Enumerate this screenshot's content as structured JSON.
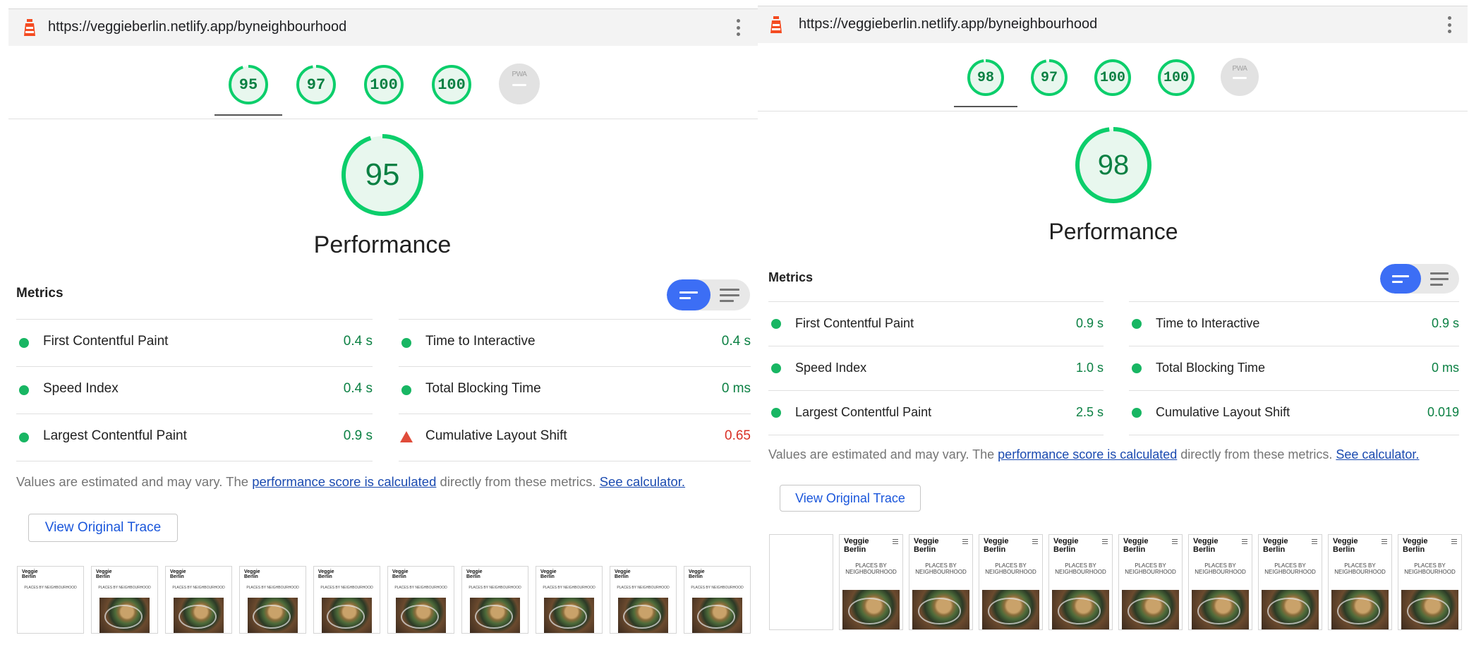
{
  "panels": [
    {
      "url": "https://veggieberlin.netlify.app/byneighbourhood",
      "gauges": [
        "95",
        "97",
        "100",
        "100"
      ],
      "pwa_label": "PWA",
      "score": "95",
      "category": "Performance",
      "metrics_title": "Metrics",
      "metrics": [
        {
          "label": "First Contentful Paint",
          "value": "0.4 s",
          "status": "pass"
        },
        {
          "label": "Time to Interactive",
          "value": "0.4 s",
          "status": "pass"
        },
        {
          "label": "Speed Index",
          "value": "0.4 s",
          "status": "pass"
        },
        {
          "label": "Total Blocking Time",
          "value": "0 ms",
          "status": "pass"
        },
        {
          "label": "Largest Contentful Paint",
          "value": "0.9 s",
          "status": "pass"
        },
        {
          "label": "Cumulative Layout Shift",
          "value": "0.65",
          "status": "fail"
        }
      ],
      "note": {
        "prefix": "Values are estimated and may vary. The ",
        "link1": "performance score is calculated",
        "middle": " directly from these metrics. ",
        "link2": "See calculator."
      },
      "trace_button": "View Original Trace",
      "thumb_title": "Veggie\nBerlin",
      "thumb_subtitle": "PLACES BY NEIGHBOURHOOD"
    },
    {
      "url": "https://veggieberlin.netlify.app/byneighbourhood",
      "gauges": [
        "98",
        "97",
        "100",
        "100"
      ],
      "pwa_label": "PWA",
      "score": "98",
      "category": "Performance",
      "metrics_title": "Metrics",
      "metrics": [
        {
          "label": "First Contentful Paint",
          "value": "0.9 s",
          "status": "pass"
        },
        {
          "label": "Time to Interactive",
          "value": "0.9 s",
          "status": "pass"
        },
        {
          "label": "Speed Index",
          "value": "1.0 s",
          "status": "pass"
        },
        {
          "label": "Total Blocking Time",
          "value": "0 ms",
          "status": "pass"
        },
        {
          "label": "Largest Contentful Paint",
          "value": "2.5 s",
          "status": "pass"
        },
        {
          "label": "Cumulative Layout Shift",
          "value": "0.019",
          "status": "pass"
        }
      ],
      "note": {
        "prefix": "Values are estimated and may vary. The ",
        "link1": "performance score is calculated",
        "middle": " directly from these metrics. ",
        "link2": "See calculator."
      },
      "trace_button": "View Original Trace",
      "thumb_title": "Veggie\nBerlin",
      "thumb_subtitle": "PLACES BY\nNEIGHBOURHOOD"
    }
  ],
  "colors": {
    "pass": "#0cce6b",
    "pass_text": "#0b8043",
    "fail": "#e04c3a",
    "toggle_active": "#3c6ef5"
  }
}
